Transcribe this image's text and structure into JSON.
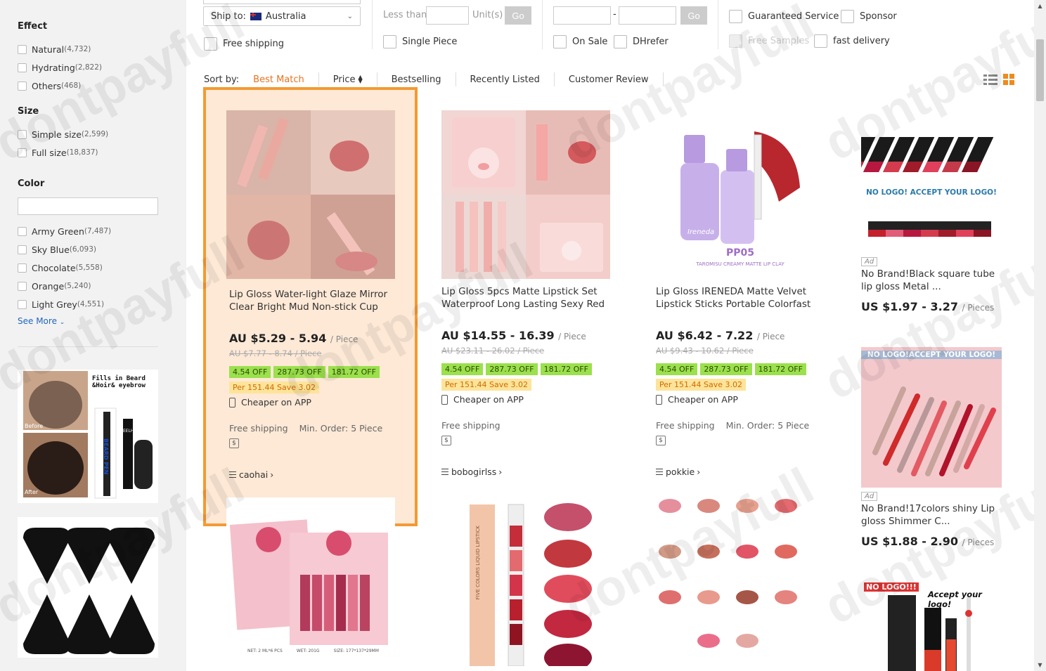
{
  "sidebar": {
    "effect": {
      "title": "Effect",
      "items": [
        {
          "label": "Natural",
          "count": "(4,732)"
        },
        {
          "label": "Hydrating",
          "count": "(2,822)"
        },
        {
          "label": "Others",
          "count": "(468)"
        }
      ]
    },
    "size": {
      "title": "Size",
      "items": [
        {
          "label": "Simple size",
          "count": "(2,599)"
        },
        {
          "label": "Full size",
          "count": "(18,837)"
        }
      ]
    },
    "color": {
      "title": "Color",
      "items": [
        {
          "label": "Army Green",
          "count": "(7,487)"
        },
        {
          "label": "Sky Blue",
          "count": "(6,093)"
        },
        {
          "label": "Chocolate",
          "count": "(5,558)"
        },
        {
          "label": "Orange",
          "count": "(5,240)"
        },
        {
          "label": "Light Grey",
          "count": "(4,551)"
        }
      ],
      "see_more": "See More"
    },
    "ad1": {
      "line1": "Fills in Beard",
      "line2": "&Hoir& eyebrow",
      "before": "Before",
      "after": "After",
      "brand": "EELHOE",
      "pen": "BEARD PEN"
    }
  },
  "filters": {
    "ship_to_label": "Ship to:",
    "ship_to_value": "Australia",
    "free_shipping": "Free shipping",
    "less_than": "Less than",
    "units": "Unit(s)",
    "go": "Go",
    "single_piece": "Single Piece",
    "range_sep": "-",
    "on_sale": "On Sale",
    "dhrefer": "DHrefer",
    "guaranteed": "Guaranteed Service",
    "sponsor": "Sponsor",
    "free_samples": "Free Samples",
    "fast_delivery": "fast delivery"
  },
  "sort": {
    "label": "Sort by:",
    "items": [
      "Best Match",
      "Price",
      "Bestselling",
      "Recently Listed",
      "Customer Review"
    ]
  },
  "products": [
    {
      "title": "Lip Gloss Water-light Glaze Mirror Clear Bright Mud Non-stick Cup",
      "price": "AU $5.29 - 5.94",
      "unit": "/ Piece",
      "old": "AU $7.77 - 8.74 / Piece",
      "coupons": [
        "4.54 OFF",
        "287.73 OFF",
        "181.72 OFF"
      ],
      "per": "Per 151.44 Save 3.02",
      "app": "Cheaper on APP",
      "ship": "Free shipping",
      "min": "Min. Order: 5 Piece",
      "seller": "caohai"
    },
    {
      "title": "Lip Gloss 5pcs Matte Lipstick Set Waterproof Long Lasting Sexy Red",
      "price": "AU $14.55 - 16.39",
      "unit": "/ Piece",
      "old": "AU $23.11 - 26.02 / Piece",
      "coupons": [
        "4.54 OFF",
        "287.73 OFF",
        "181.72 OFF"
      ],
      "per": "Per 151.44 Save 3.02",
      "app": "Cheaper on APP",
      "ship": "Free shipping",
      "min": "",
      "seller": "bobogirlss"
    },
    {
      "title": "Lip Gloss IRENEDA Matte Velvet Lipstick Sticks Portable Colorfast",
      "price": "AU $6.42 - 7.22",
      "unit": "/ Piece",
      "old": "AU $9.43 - 10.62 / Piece",
      "coupons": [
        "4.54 OFF",
        "287.73 OFF",
        "181.72 OFF"
      ],
      "per": "Per 151.44 Save 3.02",
      "app": "Cheaper on APP",
      "ship": "Free shipping",
      "min": "Min. Order: 5 Piece",
      "seller": "pokkie",
      "img_text1": "PP05",
      "img_text2": "TAROMISU CREAMY MATTE LIP CLAY",
      "img_brand": "Ireneda"
    }
  ],
  "ads": [
    {
      "badge": "Ad",
      "title": "No Brand!Black square tube lip gloss Metal ...",
      "price": "US $1.97 - 3.27",
      "unit": "/ Pieces",
      "img_text": "NO LOGO! ACCEPT YOUR LOGO!"
    },
    {
      "badge": "Ad",
      "title": "No Brand!17colors shiny Lip gloss Shimmer C...",
      "price": "US $1.88 - 2.90",
      "unit": "/ Pieces",
      "img_text": "NO LOGO!ACCEPT YOUR LOGO!"
    },
    {
      "img_text1": "NO LOGO!!!",
      "img_text2": "Accept your logo!"
    }
  ],
  "bottom_images": {
    "b1_footer": [
      "NET: 2 ML*6 PCS",
      "WET: 201G",
      "SIZE: 177*137*29MM"
    ],
    "b2_side": "FIVE COLORS LIQUID LIPSTICK"
  },
  "watermark": "dontpayfull"
}
